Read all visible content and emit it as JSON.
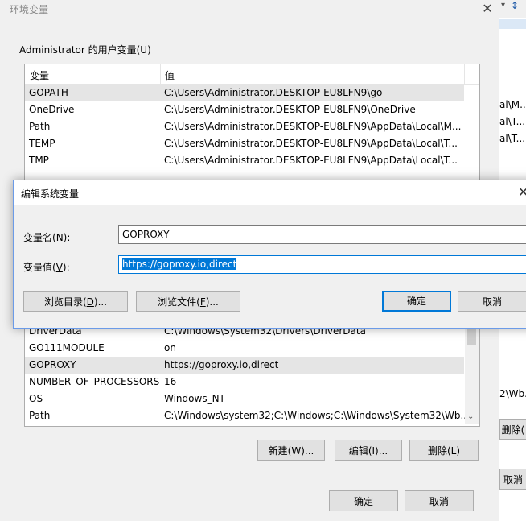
{
  "env_window": {
    "title": "环境变量",
    "close_glyph": "✕",
    "user_section_label": "Administrator 的用户变量(U)",
    "columns": {
      "name": "变量",
      "value": "值"
    },
    "user_vars": [
      {
        "name": "GOPATH",
        "value": "C:\\Users\\Administrator.DESKTOP-EU8LFN9\\go"
      },
      {
        "name": "OneDrive",
        "value": "C:\\Users\\Administrator.DESKTOP-EU8LFN9\\OneDrive"
      },
      {
        "name": "Path",
        "value": "C:\\Users\\Administrator.DESKTOP-EU8LFN9\\AppData\\Local\\M..."
      },
      {
        "name": "TEMP",
        "value": "C:\\Users\\Administrator.DESKTOP-EU8LFN9\\AppData\\Local\\T..."
      },
      {
        "name": "TMP",
        "value": "C:\\Users\\Administrator.DESKTOP-EU8LFN9\\AppData\\Local\\T..."
      }
    ],
    "system_vars": [
      {
        "name": "DriverData",
        "value": "C:\\Windows\\System32\\Drivers\\DriverData"
      },
      {
        "name": "GO111MODULE",
        "value": "on"
      },
      {
        "name": "GOPROXY",
        "value": "https://goproxy.io,direct"
      },
      {
        "name": "NUMBER_OF_PROCESSORS",
        "value": "16"
      },
      {
        "name": "OS",
        "value": "Windows_NT"
      },
      {
        "name": "Path",
        "value": "C:\\Windows\\system32;C:\\Windows;C:\\Windows\\System32\\Wb..."
      }
    ],
    "system_buttons": {
      "new": "新建(W)...",
      "edit": "编辑(I)...",
      "delete": "删除(L)"
    },
    "footer_buttons": {
      "ok": "确定",
      "cancel": "取消"
    }
  },
  "right_strip": {
    "items": [
      "al\\M...",
      "al\\T...",
      "al\\T...",
      "2\\Wb...",
      "删除(",
      "取消"
    ]
  },
  "edit_dialog": {
    "title": "编辑系统变量",
    "close_glyph": "✕",
    "name_label_prefix": "变量名(",
    "name_label_key": "N",
    "name_label_suffix": "):",
    "value_label_prefix": "变量值(",
    "value_label_key": "V",
    "value_label_suffix": "):",
    "name_value": "GOPROXY",
    "value_value": "https://goproxy.io,direct",
    "browse_dir_prefix": "浏览目录(",
    "browse_dir_key": "D",
    "browse_dir_suffix": ")...",
    "browse_file_prefix": "浏览文件(",
    "browse_file_key": "F",
    "browse_file_suffix": ")...",
    "ok": "确定",
    "cancel": "取消"
  }
}
